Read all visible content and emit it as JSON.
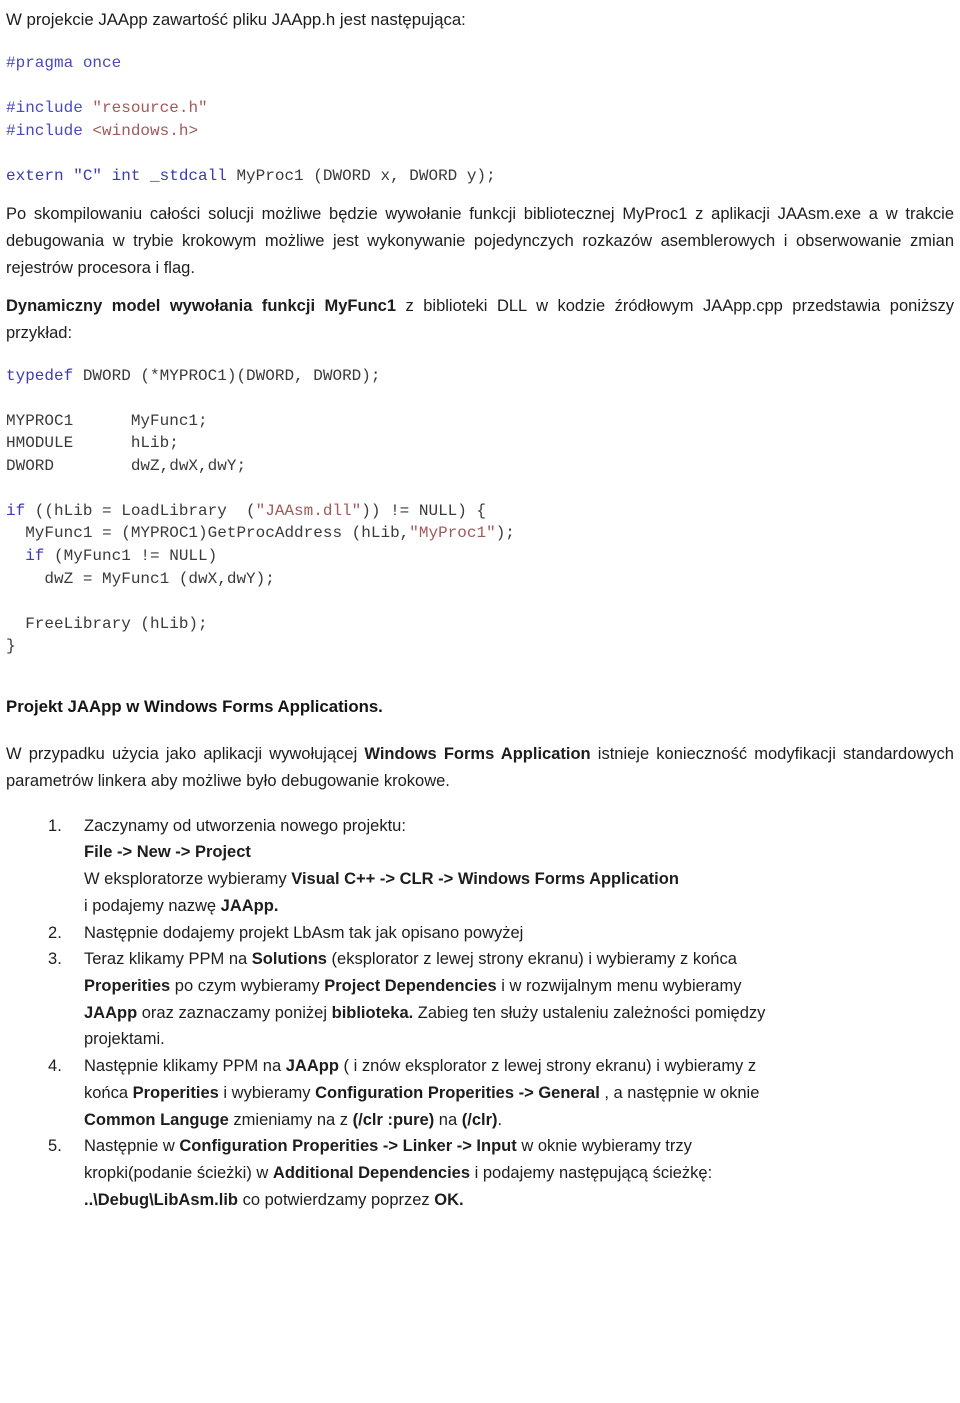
{
  "document": {
    "language": "pl",
    "colors": {
      "text": "#1d1d1d",
      "code_keyword": "#3b3bb5",
      "code_string": "#a05a5a",
      "code_plain": "#3a3a3a",
      "background": "#ffffff"
    }
  },
  "intro": {
    "line1": "W projekcie JAApp zawartość pliku JAApp.h jest następująca:"
  },
  "code_header": {
    "lines": [
      {
        "id": "pragma",
        "kw": "#pragma",
        "rest": " once"
      },
      {
        "id": "blank1",
        "kw": "",
        "rest": ""
      },
      {
        "id": "inc1a",
        "kw": "#include",
        "rest": " ",
        "str": "\"resource.h\""
      },
      {
        "id": "inc1b",
        "kw": "#include",
        "rest": " ",
        "str": "<windows.h>"
      },
      {
        "id": "blank2",
        "kw": "",
        "rest": ""
      },
      {
        "id": "externln",
        "kw": "extern \"C\" int _stdcall",
        "rest": " MyProc1 (DWORD x, DWORD y);"
      }
    ],
    "pragma_kw": "#pragma",
    "pragma_rest": " once",
    "include1_kw": "#include",
    "include1_str": "\"resource.h\"",
    "include2_kw": "#include",
    "include2_str": "<windows.h>",
    "extern_kw": "extern \"C\" int _stdcall",
    "extern_rest": " MyProc1 (DWORD x, DWORD y);"
  },
  "para1": {
    "text_a": "Po skompilowaniu całości solucji możliwe będzie wywołanie funkcji bibliotecznej MyProc1 z aplikacji JAAsm.exe a w trakcie debugowania w trybie krokowym możliwe jest wykonywanie pojedynczych rozkazów asemblerowych i obserwowanie zmian rejestrów procesora i flag."
  },
  "para2": {
    "bold_lead": "Dynamiczny model wywołania funkcji MyFunc1",
    "rest": " z biblioteki DLL w kodzie źródłowym JAApp.cpp przedstawia poniższy przykład:"
  },
  "code_dynamic": {
    "typedef_kw": "typedef",
    "typedef_rest": " DWORD (*MYPROC1)(DWORD, DWORD);",
    "decl1": "MYPROC1      MyFunc1;",
    "decl2": "HMODULE      hLib;",
    "decl3": "DWORD        dwZ,dwX,dwY;",
    "if1_kw": "if",
    "if1_mid": " ((hLib = LoadLibrary  (",
    "if1_str": "\"JAAsm.dll\"",
    "if1_end": ")) != NULL) {",
    "call_pre": "  MyFunc1 = (MYPROC1)GetProcAddress (hLib,",
    "call_str": "\"MyProc1\"",
    "call_end": ");",
    "if2_kw": "  if",
    "if2_rest": " (MyFunc1 != NULL)",
    "assign": "    dwZ = MyFunc1 (dwX,dwY);",
    "free": "  FreeLibrary (hLib);",
    "closing_brace": "}"
  },
  "heading1": {
    "text": "Projekt JAApp w Windows Forms Applications."
  },
  "para3": {
    "seg_a": "W przypadku użycia jako aplikacji wywołującej ",
    "seg_b_bold": "Windows Forms Application",
    "seg_c": " istnieje konieczność modyfikacji standardowych parametrów linkera aby możliwe było debugowanie krokowe."
  },
  "steps": [
    {
      "id": "step-1",
      "lines": [
        {
          "type": "plain",
          "text": "Zaczynamy od utworzenia nowego projektu:"
        },
        {
          "type": "bold",
          "text": "File -> New -> Project"
        },
        {
          "type": "mixed",
          "a": "W eksploratorze wybieramy ",
          "b": "Visual C++ -> CLR -> Windows Forms Application",
          "c": ""
        },
        {
          "type": "mixed",
          "a": "i podajemy nazwę ",
          "b": "JAApp.",
          "c": ""
        }
      ]
    },
    {
      "id": "step-2",
      "lines": [
        {
          "type": "plain",
          "text": "Następnie dodajemy projekt LbAsm tak jak opisano powyżej"
        }
      ]
    },
    {
      "id": "step-3",
      "lines": [
        {
          "type": "mixed",
          "a": "Teraz klikamy PPM na ",
          "b": "Solutions",
          "c": " (eksplorator z lewej strony ekranu)  i wybieramy z końca"
        },
        {
          "type": "mixed",
          "a": "",
          "b": "Properities",
          "c": " po czym wybieramy ",
          "d_bold": "Project Dependencies",
          "e": " i w rozwijalnym menu wybieramy"
        },
        {
          "type": "mixed",
          "a": "",
          "b": "JAApp",
          "c": " oraz zaznaczamy poniżej ",
          "d_bold": "biblioteka.",
          "e": " Zabieg ten służy ustaleniu zależności pomiędzy"
        },
        {
          "type": "plain",
          "text": "projektami."
        }
      ]
    },
    {
      "id": "step-4",
      "lines": [
        {
          "type": "mixed",
          "a": "Następnie klikamy PPM na ",
          "b": "JAApp",
          "c": " ( i znów eksplorator z lewej strony ekranu)  i wybieramy z"
        },
        {
          "type": "mixed",
          "a": "końca ",
          "b": "Properities",
          "c": " i wybieramy ",
          "d_bold": "Configuration Properities -> General",
          "e": " , a następnie w oknie"
        },
        {
          "type": "mixed",
          "a": "",
          "b": "Common Languge",
          "c": " zmieniamy  na z ",
          "d_bold": "(/clr :pure)",
          "e": " na ",
          "f_bold": "(/clr)",
          "g": "."
        }
      ]
    },
    {
      "id": "step-5",
      "lines": [
        {
          "type": "mixed",
          "a": "Następnie w ",
          "b": "Configuration Properities -> Linker -> Input",
          "c": "  w oknie wybieramy trzy"
        },
        {
          "type": "mixed",
          "a": "kropki(podanie ścieżki) w ",
          "b": "Additional Dependencies",
          "c": "  i podajemy następującą ścieżkę:"
        },
        {
          "type": "mixed",
          "a": "",
          "b": "..\\Debug\\LibAsm.lib",
          "c": " co potwierdzamy poprzez ",
          "d_bold": "OK.",
          "e": ""
        }
      ]
    }
  ]
}
